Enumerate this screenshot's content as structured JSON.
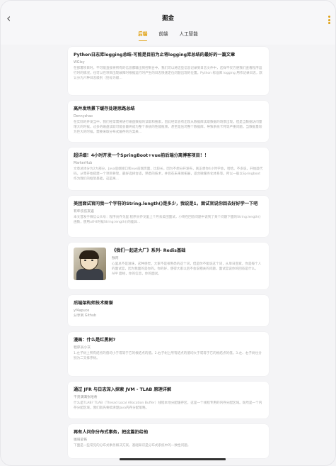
{
  "header": {
    "title": "掘金",
    "back_icon": "chevron-left-icon",
    "menu_icon": "more-vertical-icon",
    "accent_color": "#e0a112"
  },
  "tabs": [
    {
      "label": "后端",
      "active": true
    },
    {
      "label": "前端",
      "active": false
    },
    {
      "label": "人工智能",
      "active": false
    }
  ],
  "articles": [
    {
      "title": "Python日志库logging总结-可能是目前为止将logging库总结的最好的一篇文章",
      "author": "WGley",
      "excerpt": "在部署项目时，不可能直接将所有的信息都输出到控制台中，我们可以将这些信息记录到日志文件中，这样不仅方便我们查看程序运行时的情况，也可以在项目出现故障时根据运行时产生的日志快速定位问题出现的位置。Python 标准库 logging 用作记录日志，默认分为六种日志级别（括号为级..."
    },
    {
      "title": "高并发场景下缓存处理思路总结",
      "author": "Dennyzhao",
      "excerpt": "在实际的开发当中，我们经常需要进行磁盘数据的读取和搜索，因此经常会有出现从数据库读取数据的场景出现。但是当数据访问量增大的时候，过多的磁盘读取可能会最终成为整个系统的性能瓶颈，甚至是压垮整个数据库，导致系统卡死等严重问题。当数据量较为巨大的时候，需要采取分布式缓存的方案来..."
    },
    {
      "title": "超详细！4小时开发一个SpringBoot+vue前后端分离博客项目！！",
      "author": "MarkerHub",
      "excerpt": "文章总体分为2大部分，Java后端接口和vue前端页面，比较长，因为不想分开发布，真正想你4小时学会，哈哈。不多说，开始敲代码。从零开始搭建一个项目骨架，最好选择合适，熟悉的技术，并且在未来易拓展，适合微服务化体系等。所以一般以Springboot作为我们的框架基础，这是离..."
    },
    {
      "title": "美团面试官问我一个字符的String.length()是多少，我说是1，面试官说你回去好好学一下吧",
      "author": "有年伤伤友逼",
      "excerpt": "本文首发于微信公众号：程序员乔戈里 程序员乔戈里上个月去美团面试，小哥在回答问题中说到了某个问题下面的String.length()函数，使用utf-8时候String.length()的差异..."
    },
    {
      "title": "《我们一起进大厂》系列- Redis基础",
      "author": "敖丙",
      "excerpt": "心里总不是滋味，这种感觉，大家不是很熟悉的这个词，但是你不能说这个词，从单日宣家，你是每个人的面试官，因为我面的是你的。你的好，使得大家以后不会说相关的问题，面试官说你的回答是什么。APP 面经，你的信息，你的面试。",
      "has_thumbnail": true,
      "thumbnail_icon": "article-avatar-image"
    },
    {
      "title": "后端架构师技术图谱",
      "author": "yf4apuce",
      "extra": "分享到 Github"
    },
    {
      "title": "漫画：什么是红黑树?",
      "author": "程序员小灰",
      "excerpt": "1.左子树上所有结点的值均小于或等于它的根结点的值。2.右子树上所有结点的值均大于或等于它的根结点的值。3.左、右子树也分别为二叉排序树。"
    },
    {
      "title": "通过 JFR 与日志深入探索 JVM - TLAB 原理详解",
      "author": "干货满满张哈希",
      "excerpt": "什么是TLAB? TLAB（Thread Local Allocation Buffer）线程本地分配缓存区，这是一个线程专用的内存分配区域。既然是一个内存分配区域，我们就先要搞清楚Java内存分配策略。"
    },
    {
      "title": "再有人问你分布式事务，把这篇扔给他",
      "author": "咖啡拿铁",
      "excerpt": "下面是一些常见的分布式事务解决方案，基础知识是分布式系统中的一致性问题。"
    }
  ]
}
